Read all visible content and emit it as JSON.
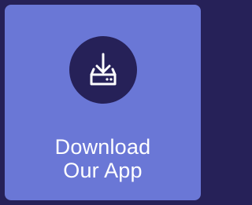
{
  "card": {
    "label_line1": "Download",
    "label_line2": "Our App",
    "icon": "download-app-icon"
  },
  "colors": {
    "background": "#262158",
    "card": "#6a77d6",
    "icon_circle": "#262158",
    "foreground": "#ffffff"
  }
}
